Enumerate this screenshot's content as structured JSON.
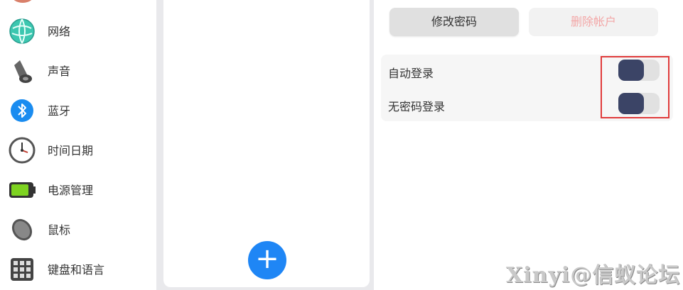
{
  "sidebar": {
    "items": [
      {
        "label": "网络",
        "icon": "network-icon"
      },
      {
        "label": "声音",
        "icon": "speaker-icon"
      },
      {
        "label": "蓝牙",
        "icon": "bluetooth-icon"
      },
      {
        "label": "时间日期",
        "icon": "clock-icon"
      },
      {
        "label": "电源管理",
        "icon": "battery-icon"
      },
      {
        "label": "鼠标",
        "icon": "mouse-icon"
      },
      {
        "label": "键盘和语言",
        "icon": "keyboard-icon"
      }
    ]
  },
  "middle": {
    "add_label": "+"
  },
  "account": {
    "change_password": "修改密码",
    "delete_account": "删除帐户",
    "settings": [
      {
        "label": "自动登录",
        "enabled": true
      },
      {
        "label": "无密码登录",
        "enabled": true
      }
    ]
  },
  "watermark": "Xinyi@信蚁论坛",
  "colors": {
    "accent": "#1f86f5",
    "toggle_knob": "#3b4466",
    "highlight": "#e03b3b",
    "delete_text": "#f3a7a7"
  }
}
